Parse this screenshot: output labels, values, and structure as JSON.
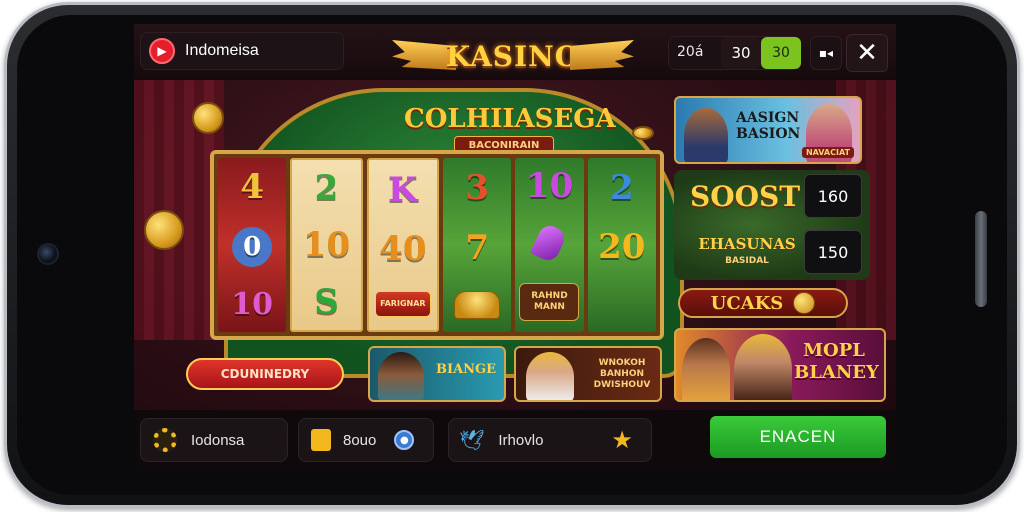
{
  "header": {
    "region_label": "Indomeisa",
    "logo_text": "KASINO",
    "balance": {
      "amount": "20á",
      "bet": "30",
      "win": "30"
    }
  },
  "game": {
    "title": "COLHIIASEGA",
    "subtitle": "BACONIRAIN",
    "reels": [
      {
        "symbols": [
          "4",
          "0",
          "10"
        ],
        "style": "red",
        "colors": [
          "#f2c23a",
          "#ffffff",
          "#e05ad0"
        ]
      },
      {
        "symbols": [
          "2",
          "10",
          "S"
        ],
        "style": "cream",
        "colors": [
          "#39a83a",
          "#e5901e",
          "#2aa83a"
        ]
      },
      {
        "symbols": [
          "K",
          "40",
          ""
        ],
        "style": "cream",
        "colors": [
          "#c84ae0",
          "#e5901e",
          "#ffffff"
        ]
      },
      {
        "symbols": [
          "3",
          "7",
          ""
        ],
        "style": "green",
        "colors": [
          "#e8502a",
          "#f2a41e",
          "#ffffff"
        ]
      },
      {
        "symbols": [
          "10",
          "",
          "RAHND MANN"
        ],
        "style": "green",
        "colors": [
          "#c84ae0",
          "#ffffff",
          "#ffd07a"
        ]
      },
      {
        "symbols": [
          "2",
          "20",
          ""
        ],
        "style": "green",
        "colors": [
          "#3a8ae0",
          "#f2b81e",
          "#ffffff"
        ]
      }
    ],
    "reel_badge": "FARIGNAR",
    "cta_label": "CDUNINEDRY"
  },
  "promos": {
    "top_text": "AASIGN BASION",
    "top_tag": "NAVACIAT",
    "boost_title": "SOOST",
    "boost_value": "160",
    "bonus_title": "EHASUNAS",
    "bonus_sub": "BASIDAL",
    "bonus_value": "150",
    "deals_label": "UCAKS",
    "bottom_text": "MOPL BLANEY",
    "card_a_text": "BIANGE",
    "card_b_text": "WNOKOH BANHON DWISHOUV"
  },
  "bottombar": {
    "region_label": "Iodonsa",
    "coins_label": "8ouo",
    "social_label": "Irhovlo",
    "enter_label": "ENACEN"
  },
  "colors": {
    "accent_gold": "#d6a64a",
    "enter_green": "#2fb82f",
    "brand_red": "#e41e2b"
  }
}
